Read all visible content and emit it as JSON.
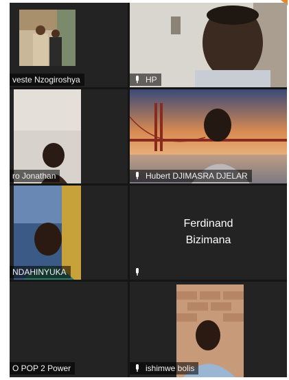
{
  "participants": [
    {
      "id": "p1",
      "name": "veste Nzogiroshya",
      "mic": false
    },
    {
      "id": "p2",
      "name": "HP",
      "mic": true
    },
    {
      "id": "p3",
      "name": "ro Jonathan",
      "mic": false
    },
    {
      "id": "p4",
      "name": "Hubert DJIMASRA DJELAR",
      "mic": true
    },
    {
      "id": "p5",
      "name": "NDAHINYUKA",
      "mic": false
    },
    {
      "id": "p6",
      "name_line1": "Ferdinand",
      "name_line2": "Bizimana",
      "mic": true
    },
    {
      "id": "p7",
      "name": "O POP 2 Power",
      "mic": false
    },
    {
      "id": "p8",
      "name": "ishimwe bolis",
      "mic": true
    }
  ],
  "colors": {
    "grid_bg": "#151515",
    "tile_bg": "#232323",
    "accent": "#e8871e"
  },
  "icons": {
    "mic": "microphone-icon"
  }
}
